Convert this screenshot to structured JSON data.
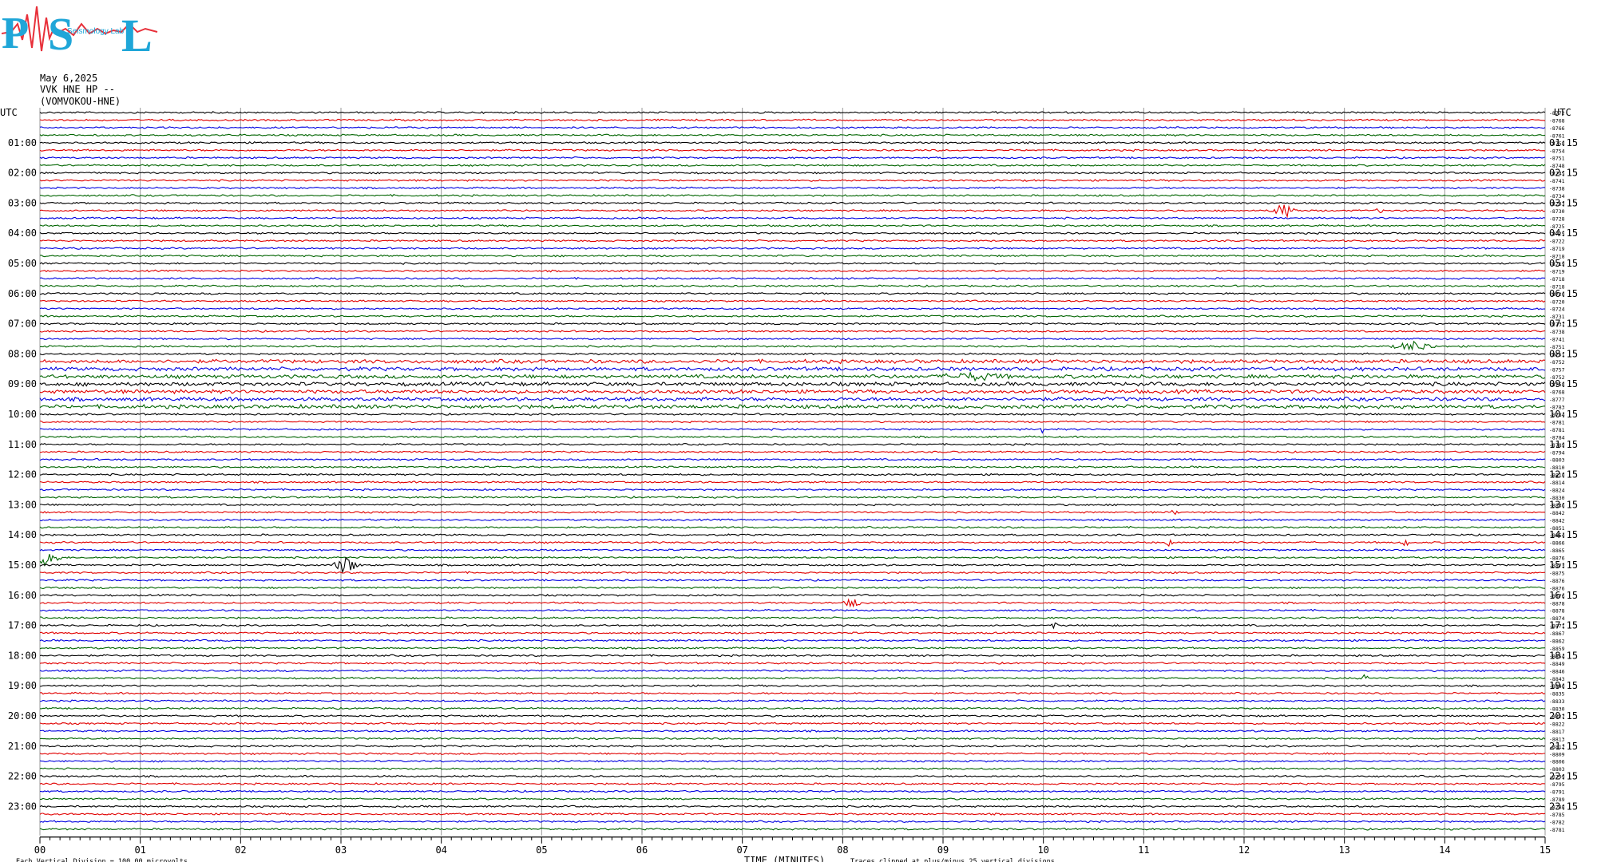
{
  "header": {
    "date": "May 6,2025",
    "station": "VVK HNE HP --",
    "site": "(VOMVOKOU-HNE)"
  },
  "logo": {
    "letters": [
      "P",
      "S",
      "L"
    ],
    "text": "Seismology Lab",
    "colors": {
      "letters": "#1fa6d8",
      "trace": "#e8303a"
    }
  },
  "chart_data": {
    "type": "line",
    "title": "",
    "xlabel": "TIME (MINUTES)",
    "ylabel": "UTC",
    "left_axis_title": "UTC",
    "right_axis_title": "UTC",
    "xlim": [
      0,
      15
    ],
    "x_ticks": [
      "00",
      "01",
      "02",
      "03",
      "04",
      "05",
      "06",
      "07",
      "08",
      "09",
      "10",
      "11",
      "12",
      "13",
      "14",
      "15"
    ],
    "left_hour_labels": [
      "01:00",
      "02:00",
      "03:00",
      "04:00",
      "05:00",
      "06:00",
      "07:00",
      "08:00",
      "09:00",
      "10:00",
      "11:00",
      "12:00",
      "13:00",
      "14:00",
      "15:00",
      "16:00",
      "17:00",
      "18:00",
      "19:00",
      "20:00",
      "21:00",
      "22:00",
      "23:00"
    ],
    "right_hour_labels": [
      "01:15",
      "02:15",
      "03:15",
      "04:15",
      "05:15",
      "06:15",
      "07:15",
      "08:15",
      "09:15",
      "10:15",
      "11:15",
      "12:15",
      "13:15",
      "14:15",
      "15:15",
      "16:15",
      "17:15",
      "18:15",
      "19:15",
      "20:15",
      "21:15",
      "22:15",
      "23:15"
    ],
    "trace_colors": [
      "#000000",
      "#e00000",
      "#0000e0",
      "#006400"
    ],
    "rows_per_hour": 4,
    "row_count": 96,
    "row_values": [
      -8772,
      -8768,
      -8766,
      -8761,
      -8758,
      -8754,
      -8751,
      -8748,
      -8745,
      -8741,
      -8738,
      -8734,
      -8733,
      -8730,
      -8728,
      -8725,
      -8725,
      -8722,
      -8719,
      -8718,
      -8719,
      -8719,
      -8718,
      -8718,
      -8720,
      -8720,
      -8724,
      -8731,
      -8737,
      -8738,
      -8741,
      -8751,
      -8751,
      -8752,
      -8757,
      -8752,
      -8758,
      -8768,
      -8777,
      -8783,
      -8784,
      -8781,
      -8781,
      -8784,
      -8789,
      -8794,
      -8803,
      -8810,
      -8810,
      -8814,
      -8824,
      -8830,
      -8836,
      -8842,
      -8842,
      -8851,
      -8854,
      -8866,
      -8865,
      -8876,
      -8873,
      -8875,
      -8876,
      -8876,
      -8876,
      -8878,
      -8878,
      -8874,
      -8871,
      -8867,
      -8862,
      -8859,
      -8854,
      -8849,
      -8846,
      -8843,
      -8840,
      -8835,
      -8833,
      -8830,
      -8827,
      -8822,
      -8817,
      -8813,
      -8812,
      -8809,
      -8806,
      -8803,
      -8799,
      -8795,
      -8791,
      -8789,
      -8788,
      -8785,
      -8782,
      -8781
    ],
    "events": [
      {
        "row": 13,
        "minute": 12.4,
        "amp": 9,
        "dur": 0.15
      },
      {
        "row": 13,
        "minute": 13.35,
        "amp": 3,
        "dur": 0.05
      },
      {
        "row": 31,
        "minute": 13.7,
        "amp": 6,
        "dur": 0.25
      },
      {
        "row": 35,
        "minute": 9.3,
        "amp": 4,
        "dur": 0.4
      },
      {
        "row": 42,
        "minute": 10.0,
        "amp": 7,
        "dur": 0.04
      },
      {
        "row": 53,
        "minute": 11.3,
        "amp": 3,
        "dur": 0.05
      },
      {
        "row": 57,
        "minute": 11.25,
        "amp": 4,
        "dur": 0.05
      },
      {
        "row": 57,
        "minute": 13.6,
        "amp": 8,
        "dur": 0.04
      },
      {
        "row": 59,
        "minute": 0.08,
        "amp": 12,
        "dur": 0.15
      },
      {
        "row": 60,
        "minute": 3.05,
        "amp": 11,
        "dur": 0.15
      },
      {
        "row": 65,
        "minute": 8.1,
        "amp": 6,
        "dur": 0.1
      },
      {
        "row": 68,
        "minute": 10.1,
        "amp": 4,
        "dur": 0.05
      },
      {
        "row": 75,
        "minute": 13.2,
        "amp": 6,
        "dur": 0.04
      }
    ],
    "noisy_rows": [
      33,
      34,
      35,
      36,
      37,
      38,
      39
    ],
    "footer_left": "Each Vertical Division =  100.00 microvolts",
    "footer_note": "Traces clipped at plus/minus 25 vertical divisions"
  }
}
